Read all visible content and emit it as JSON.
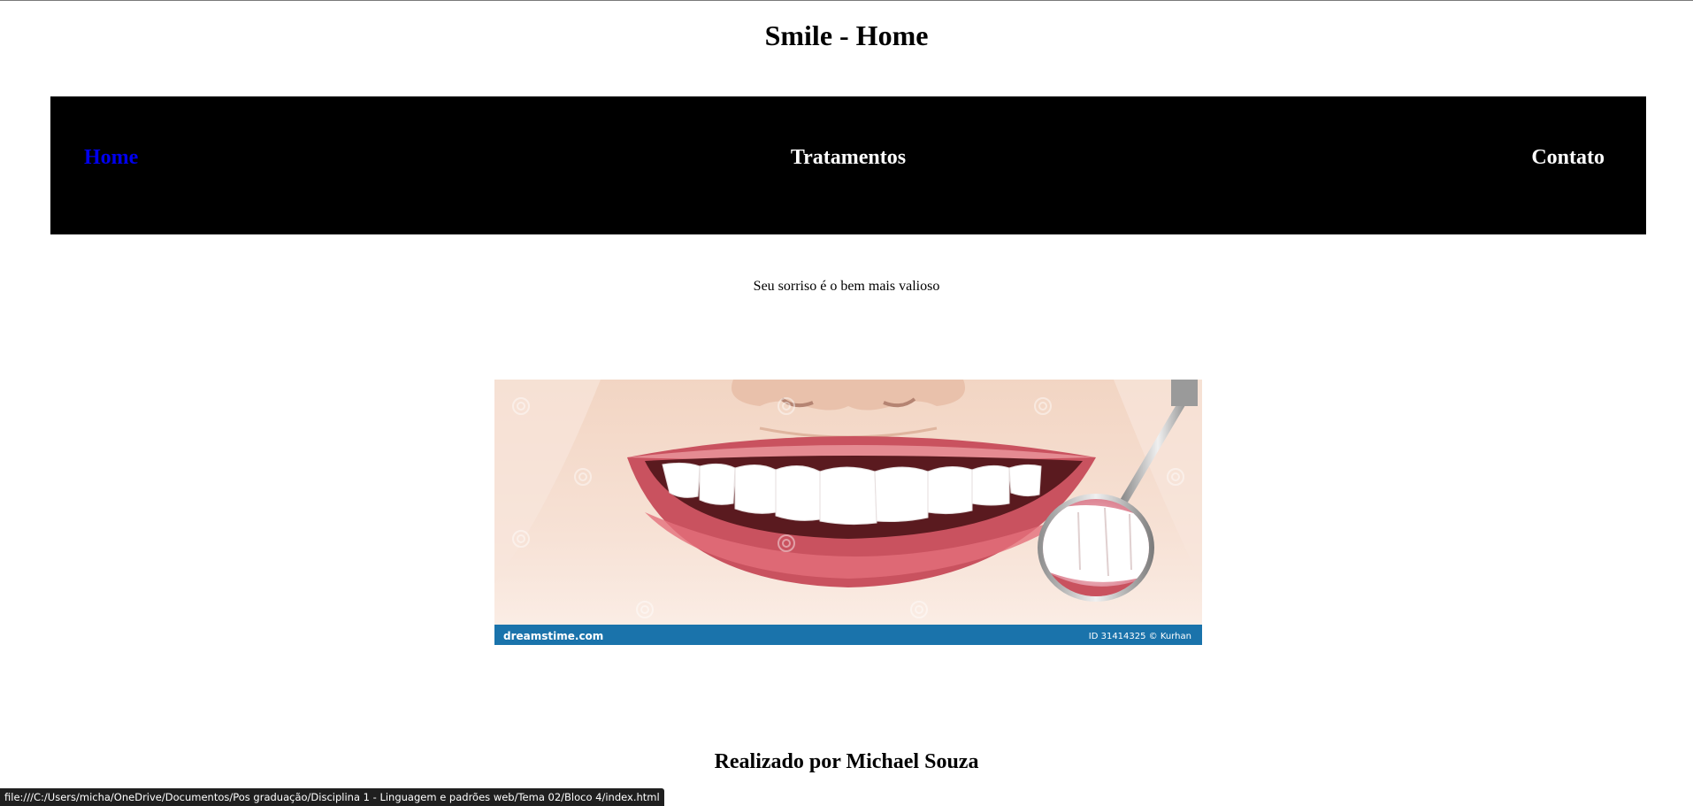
{
  "header": {
    "title": "Smile - Home"
  },
  "nav": {
    "items": [
      {
        "label": "Home",
        "active": true
      },
      {
        "label": "Tratamentos",
        "active": false
      },
      {
        "label": "Contato",
        "active": false
      }
    ],
    "active_color": "#0000ee",
    "link_color": "#ffffff",
    "background": "#000000"
  },
  "main": {
    "tagline": "Seu sorriso é o bem mais valioso",
    "hero_image": {
      "watermark_left": "dreamstime.com",
      "watermark_right": "ID 31414325 © Kurhan",
      "watermark_bar_color": "#1a73ab"
    }
  },
  "footer": {
    "credit": "Realizado por Michael Souza"
  },
  "status_bar": {
    "url": "file:///C:/Users/micha/OneDrive/Documentos/Pos graduação/Disciplina 1 - Linguagem e padrões web/Tema 02/Bloco 4/index.html"
  }
}
